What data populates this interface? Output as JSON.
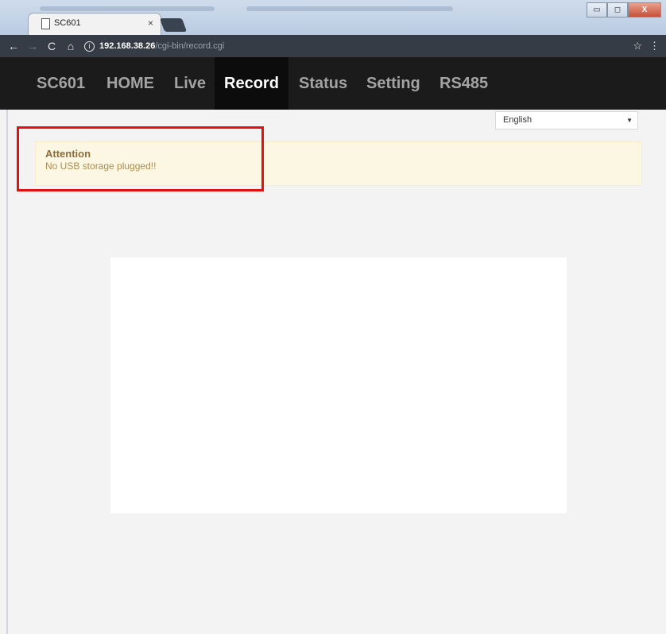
{
  "browser": {
    "tab_title": "SC601",
    "tab_close": "×",
    "url_host": "192.168.38.26",
    "url_path": "/cgi-bin/record.cgi",
    "star": "☆",
    "menu": "⋮",
    "back": "←",
    "forward": "→",
    "reload": "C",
    "home": "⌂",
    "info": "i",
    "window_buttons": {
      "minimize": "▭",
      "maximize": "◻",
      "close": "X"
    }
  },
  "navbar": {
    "brand": "SC601",
    "items": [
      {
        "label": "HOME"
      },
      {
        "label": "Live"
      },
      {
        "label": "Record",
        "active": true
      },
      {
        "label": "Status"
      },
      {
        "label": "Setting"
      },
      {
        "label": "RS485"
      }
    ]
  },
  "language": {
    "selected": "English",
    "caret": "▼"
  },
  "alert": {
    "title": "Attention",
    "message": "No USB storage plugged!!"
  },
  "colors": {
    "highlight": "#e21010",
    "alert_bg": "#fcf7e3",
    "navbar_bg": "#1b1b1b"
  }
}
